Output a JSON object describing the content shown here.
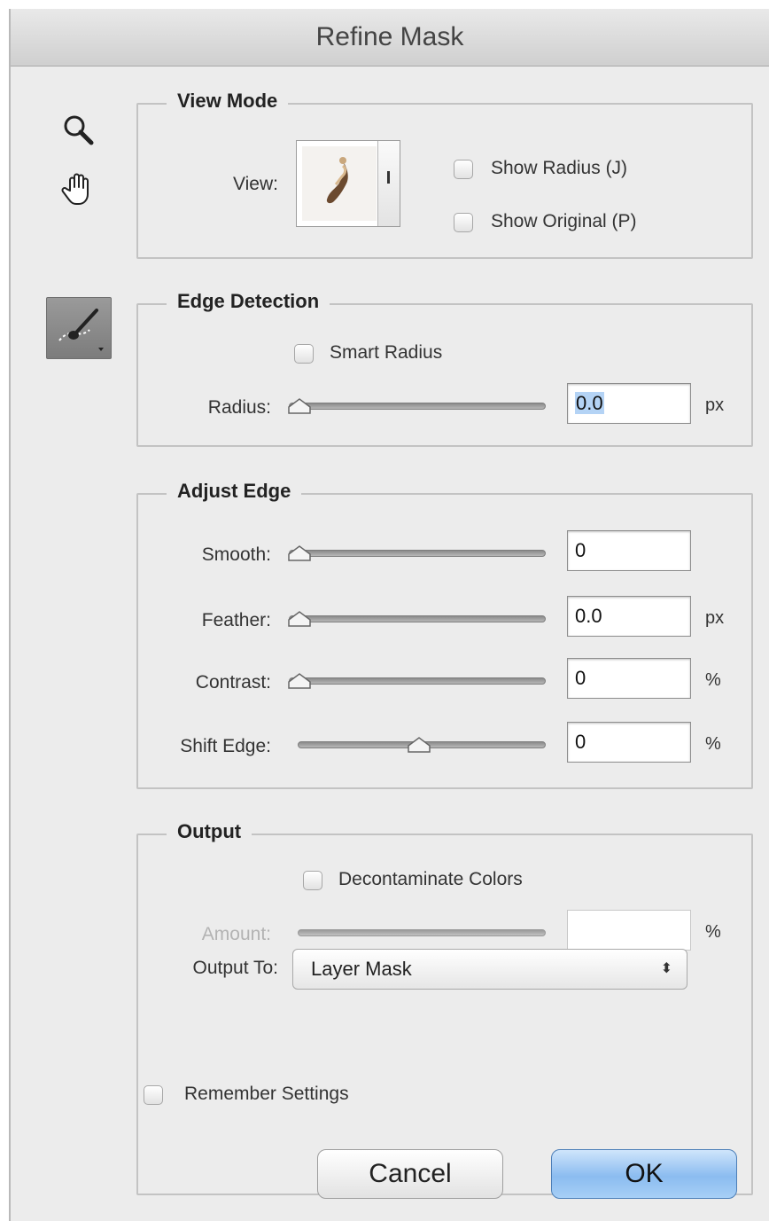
{
  "window": {
    "title": "Refine Mask"
  },
  "tools": {
    "zoom": "zoom-icon",
    "hand": "hand-icon",
    "refine_brush": "refine-radius-brush-icon"
  },
  "view_mode": {
    "legend": "View Mode",
    "view_label": "View:",
    "show_radius": {
      "label": "Show Radius (J)",
      "checked": false
    },
    "show_original": {
      "label": "Show Original (P)",
      "checked": false
    }
  },
  "edge_detection": {
    "legend": "Edge Detection",
    "smart_radius": {
      "label": "Smart Radius",
      "checked": false
    },
    "radius": {
      "label": "Radius:",
      "value": "0.0",
      "unit": "px",
      "slider_fraction": 0
    }
  },
  "adjust_edge": {
    "legend": "Adjust Edge",
    "smooth": {
      "label": "Smooth:",
      "value": "0",
      "unit": "",
      "slider_fraction": 0
    },
    "feather": {
      "label": "Feather:",
      "value": "0.0",
      "unit": "px",
      "slider_fraction": 0
    },
    "contrast": {
      "label": "Contrast:",
      "value": "0",
      "unit": "%",
      "slider_fraction": 0
    },
    "shift_edge": {
      "label": "Shift Edge:",
      "value": "0",
      "unit": "%",
      "slider_fraction": 0.5
    }
  },
  "output": {
    "legend": "Output",
    "decontaminate": {
      "label": "Decontaminate Colors",
      "checked": false
    },
    "amount": {
      "label": "Amount:",
      "value": "",
      "unit": "%",
      "disabled": true
    },
    "output_to": {
      "label": "Output To:",
      "selected": "Layer Mask"
    }
  },
  "remember_settings": {
    "label": "Remember Settings",
    "checked": false
  },
  "buttons": {
    "cancel": "Cancel",
    "ok": "OK"
  },
  "colors": {
    "ok_button": "#8bbcf0",
    "selection": "#b4d3f5"
  }
}
